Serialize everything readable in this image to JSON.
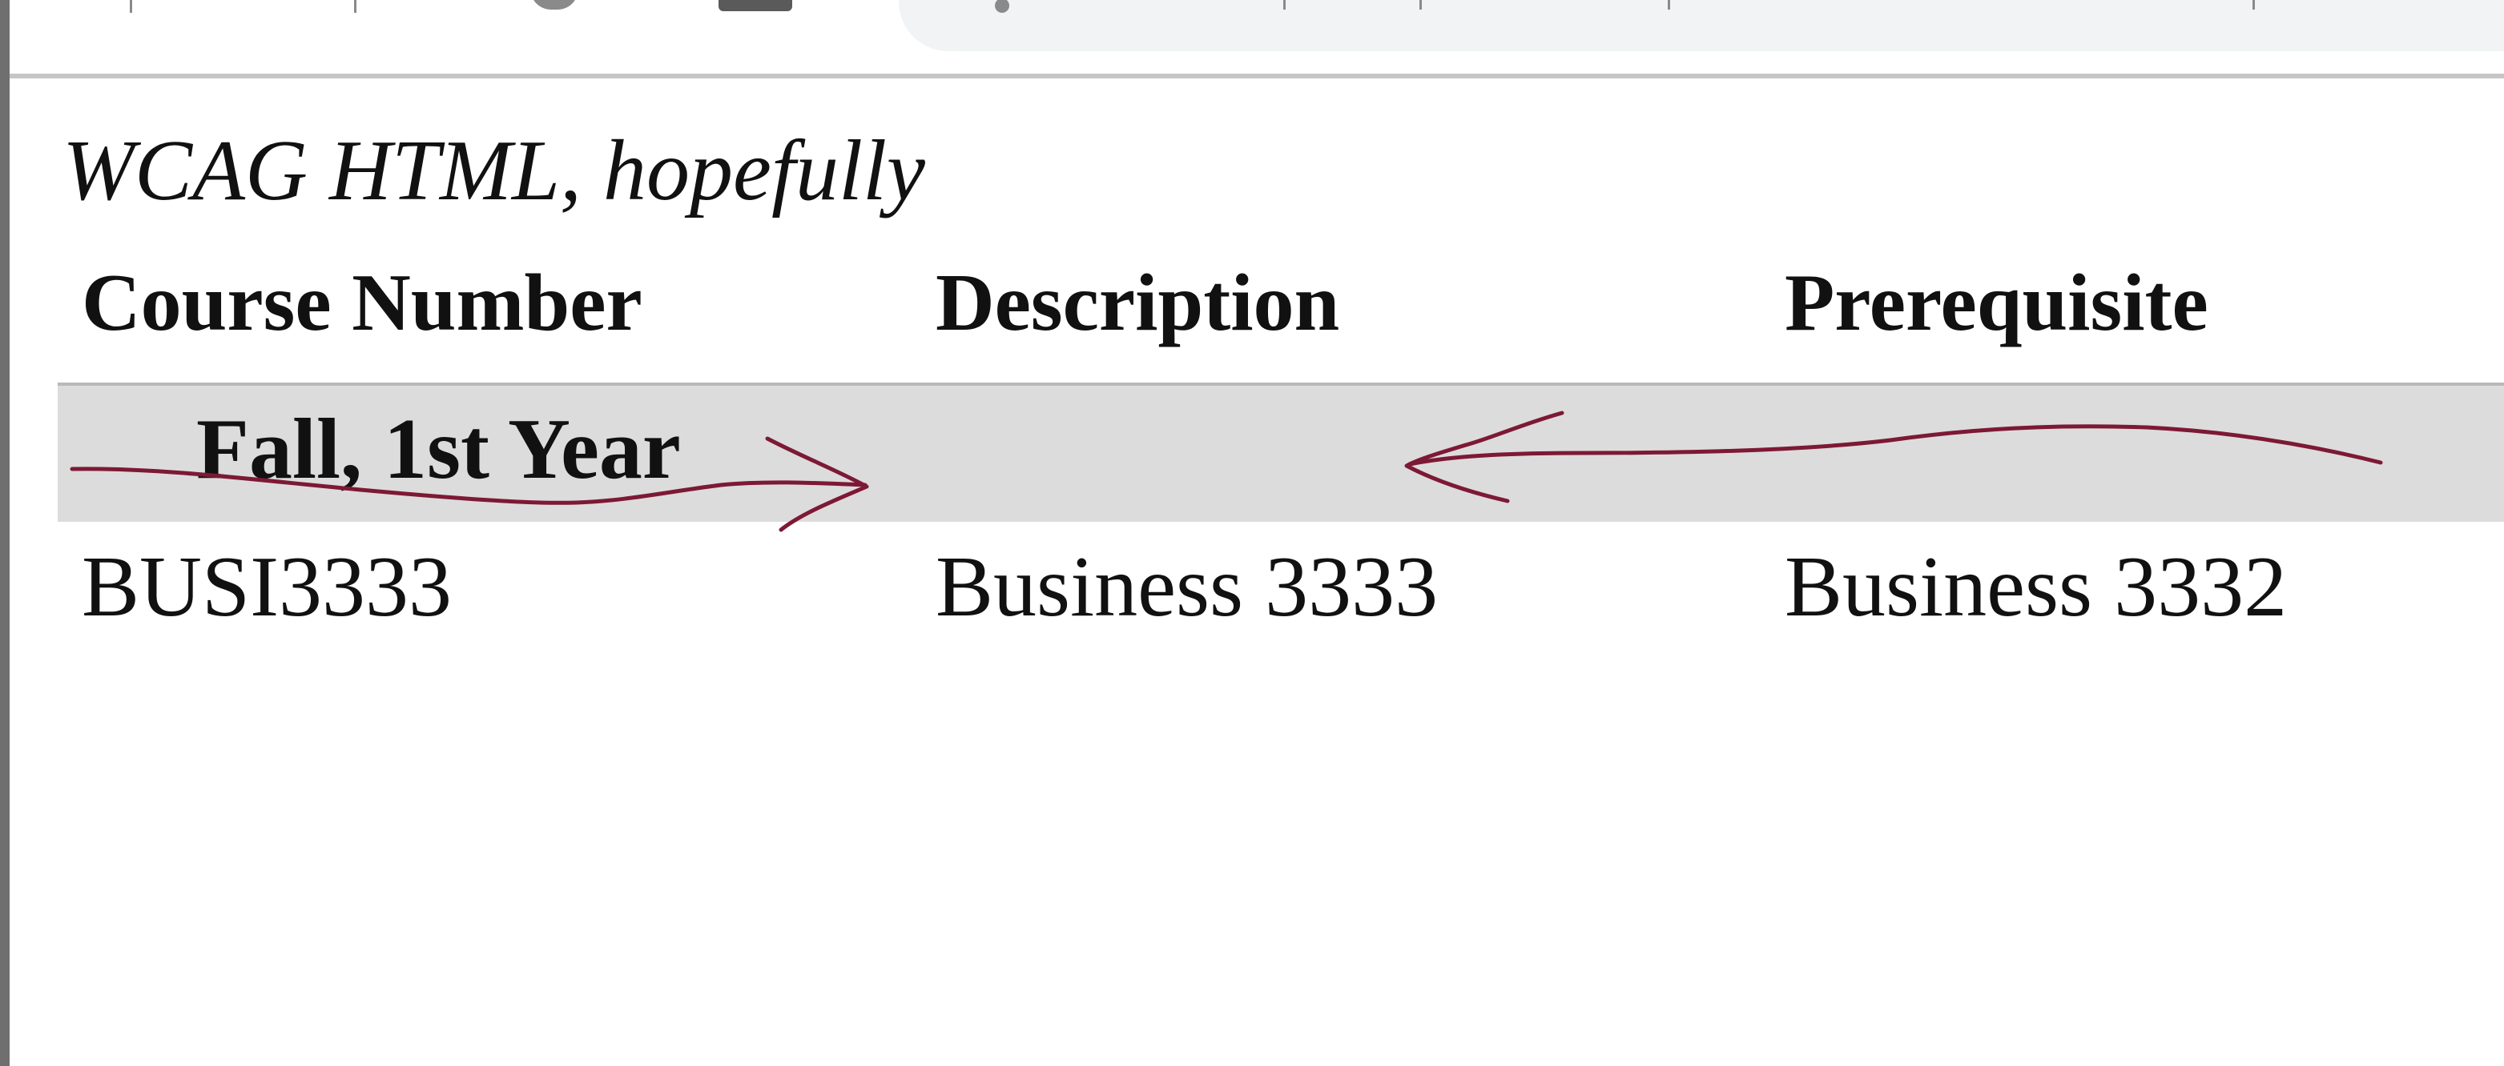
{
  "table": {
    "caption": "WCAG HTML, hopefully",
    "headers": [
      "Course Number",
      "Description",
      "Prerequisite"
    ],
    "group_row": {
      "label": "Fall, 1st Year"
    },
    "rows": [
      [
        "BUSI3333",
        "Business 3333",
        "Business 3332"
      ]
    ]
  },
  "annotation": {
    "stroke_color": "#7d1935"
  }
}
